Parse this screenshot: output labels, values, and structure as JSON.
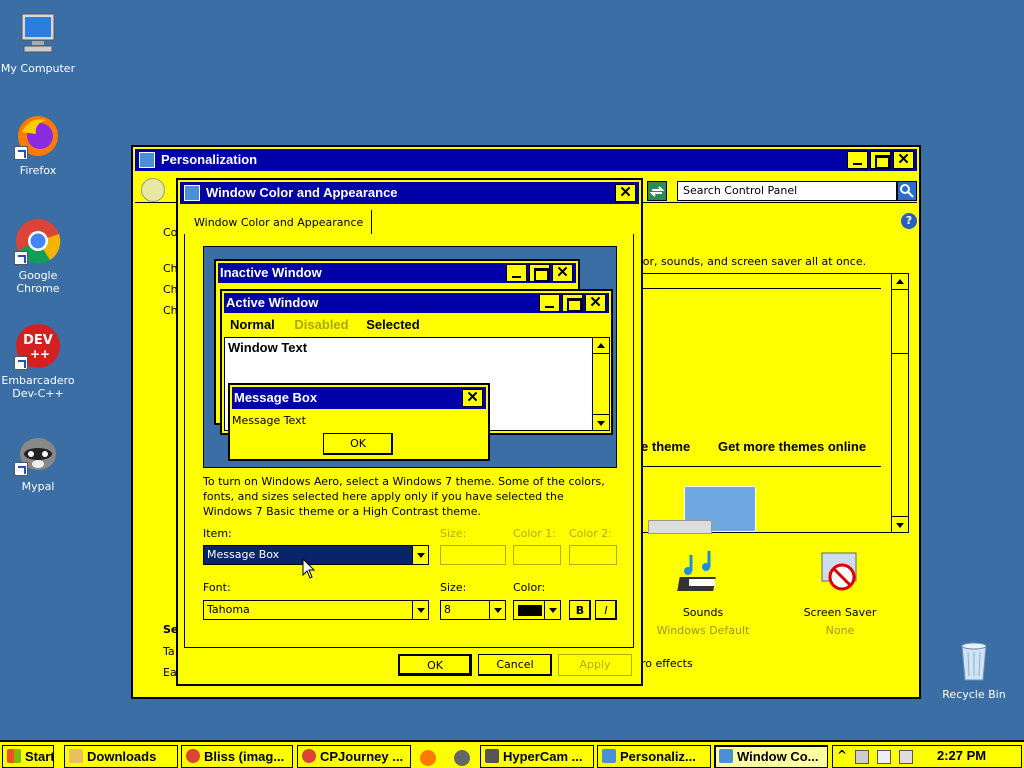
{
  "desktop": {
    "icons": [
      {
        "label": "My Computer",
        "icon": "computer-icon"
      },
      {
        "label": "Firefox",
        "icon": "firefox-icon"
      },
      {
        "label": "Google Chrome",
        "icon": "chrome-icon"
      },
      {
        "label": "Embarcadero Dev-C++",
        "icon": "devcpp-icon"
      },
      {
        "label": "Mypal",
        "icon": "mypal-icon"
      },
      {
        "label": "Recycle Bin",
        "icon": "recycle-bin-icon"
      }
    ]
  },
  "personalization": {
    "title": "Personalization",
    "search_placeholder": "Search Control Panel",
    "left_fragments": [
      "Co",
      "Ch",
      "Ch",
      "Ch",
      "Se",
      "Ta",
      "Ea"
    ],
    "description": "olor, sounds, and screen saver all at once.",
    "theme_links": [
      "re theme",
      "Get more themes online"
    ],
    "sounds": {
      "label": "Sounds",
      "value": "Windows Default"
    },
    "screensaver": {
      "label": "Screen Saver",
      "value": "None"
    },
    "aero_text": "ro effects"
  },
  "dialog": {
    "title": "Window Color and Appearance",
    "tab": "Window Color and Appearance",
    "preview": {
      "inactive_title": "Inactive Window",
      "active_title": "Active Window",
      "menu": [
        "Normal",
        "Disabled",
        "Selected"
      ],
      "window_text": "Window Text",
      "msgbox_title": "Message Box",
      "msgbox_text": "Message Text",
      "msgbox_ok": "OK"
    },
    "info": "To turn on Windows Aero, select a Windows 7 theme.  Some of the colors, fonts, and sizes selected here apply only if you have selected the Windows 7 Basic theme or a High Contrast theme.",
    "item_label": "Item:",
    "item_value": "Message Box",
    "size_label": "Size:",
    "color1_label": "Color 1:",
    "color2_label": "Color 2:",
    "font_label": "Font:",
    "font_value": "Tahoma",
    "font_size_label": "Size:",
    "font_size_value": "8",
    "font_color_label": "Color:",
    "bold": "B",
    "italic": "I",
    "ok": "OK",
    "cancel": "Cancel",
    "apply": "Apply"
  },
  "taskbar": {
    "start": "Start",
    "tasks": [
      "Downloads",
      "Bliss (imag...",
      "CPJourney ...",
      "HyperCam ...",
      "Personaliz...",
      "Window Co..."
    ],
    "clock": "2:27 PM"
  },
  "colors": {
    "window_bg": "#ffff00",
    "title_active": "#0000a8",
    "desktop": "#3a6ea5"
  }
}
